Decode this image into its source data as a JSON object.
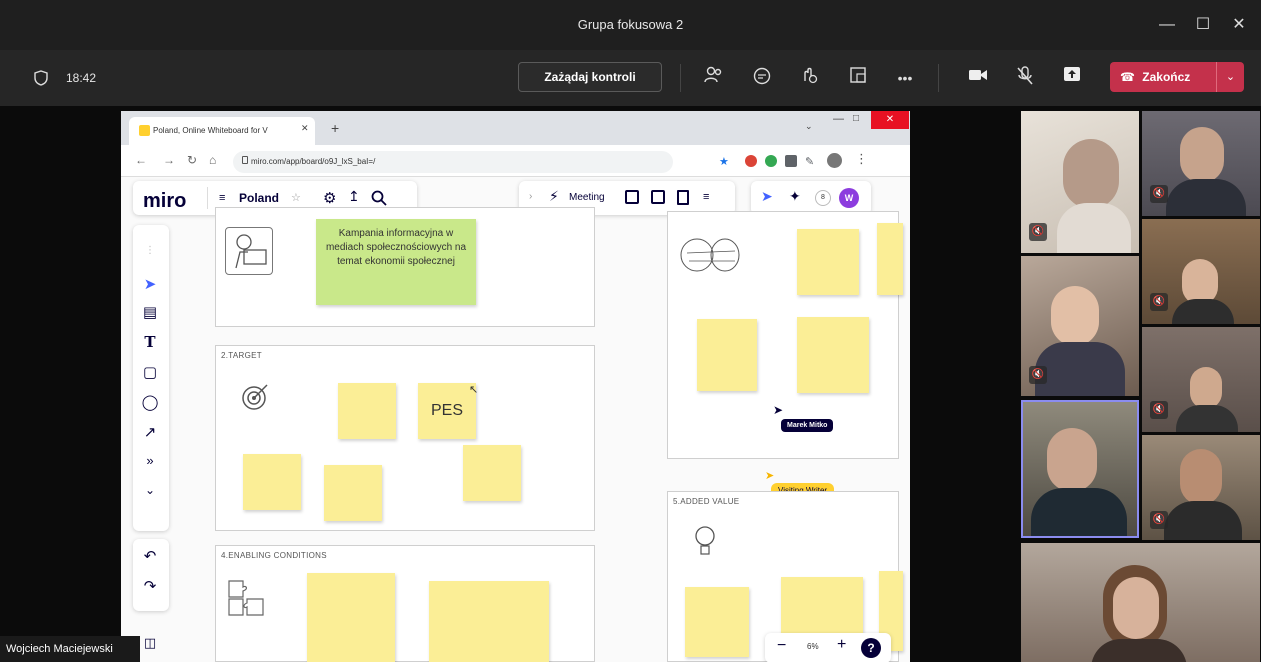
{
  "window": {
    "title": "Grupa fokusowa 2"
  },
  "toolbar": {
    "timer": "18:42",
    "request_control_label": "Zażądaj kontroli",
    "end_label": "Zakończ",
    "accent": "#c4314b"
  },
  "browser": {
    "tab_title": "Poland, Online Whiteboard for V",
    "url": "miro.com/app/board/o9J_lxS_baI=/"
  },
  "miro": {
    "logo": "miro",
    "board_name": "Poland",
    "meeting_label": "Meeting",
    "frames": {
      "title_text": "Kampania informacyjna w mediach społecznościowych na temat ekonomii społecznej",
      "target_label": "2.TARGET",
      "target_sticky": "PES",
      "enabling_label": "4.ENABLING CONDITIONS",
      "added_value_label": "5.ADDED VALUE"
    },
    "cursors": {
      "user1": "Marek Mitko",
      "user2": "Visiting Writer"
    },
    "zoom": "6%"
  },
  "participant_name": "Wojciech Maciejewski"
}
